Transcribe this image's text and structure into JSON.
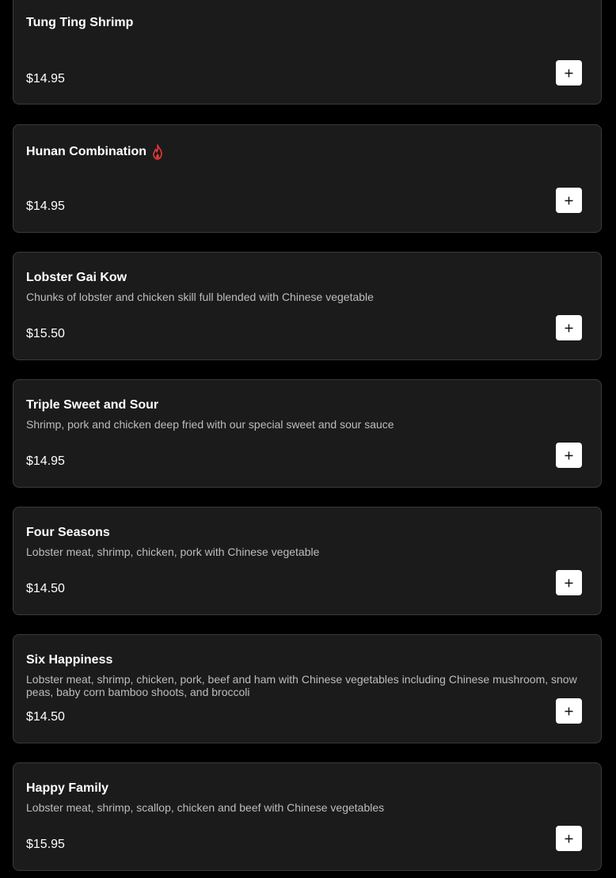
{
  "menu": {
    "items": [
      {
        "name": "Tung Ting Shrimp",
        "description": "",
        "price": "$14.95",
        "spicy": false
      },
      {
        "name": "Hunan Combination",
        "description": "",
        "price": "$14.95",
        "spicy": true
      },
      {
        "name": "Lobster Gai Kow",
        "description": "Chunks of lobster and chicken skill full blended with Chinese vegetable",
        "price": "$15.50",
        "spicy": false
      },
      {
        "name": "Triple Sweet and Sour",
        "description": "Shrimp, pork and chicken deep fried with our special sweet and sour sauce",
        "price": "$14.95",
        "spicy": false
      },
      {
        "name": "Four Seasons",
        "description": "Lobster meat, shrimp, chicken, pork with Chinese vegetable",
        "price": "$14.50",
        "spicy": false
      },
      {
        "name": "Six Happiness",
        "description": "Lobster meat, shrimp, chicken, pork, beef and ham with Chinese vegetables including Chinese mushroom, snow peas, baby corn bamboo shoots, and broccoli",
        "price": "$14.50",
        "spicy": false
      },
      {
        "name": "Happy Family",
        "description": "Lobster meat, shrimp, scallop, chicken and beef with Chinese vegetables",
        "price": "$15.95",
        "spicy": false
      }
    ]
  },
  "icons": {
    "add": "plus-icon",
    "spicy": "fire-icon"
  },
  "colors": {
    "background": "#000000",
    "card": "#1c1b1c",
    "card_border": "#3a3a3a",
    "text": "#ffffff",
    "description": "#bdbdbd",
    "spicy": "#e53935"
  }
}
